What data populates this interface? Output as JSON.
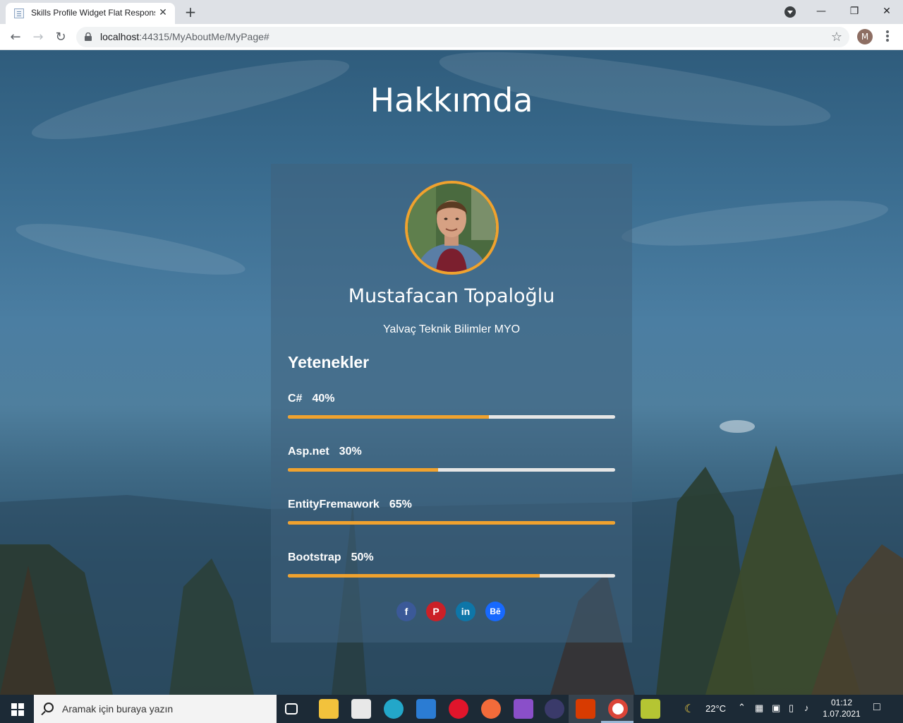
{
  "browser": {
    "tab_title": "Skills Profile Widget Flat Responsive",
    "tab_close": "✕",
    "new_tab": "+",
    "url_host": "localhost",
    "url_rest": ":44315/MyAboutMe/MyPage#",
    "profile_initial": "M",
    "window_controls": {
      "minimize": "—",
      "restore": "❐",
      "close": "✕"
    }
  },
  "page": {
    "title": "Hakkımda",
    "name": "Mustafacan Topaloğlu",
    "school": "Yalvaç Teknik Bilimler MYO",
    "skills_heading": "Yetenekler",
    "skills": [
      {
        "name": "C#",
        "percent_label": "40%",
        "bar_fill": 0.615
      },
      {
        "name": "Asp.net",
        "percent_label": "30%",
        "bar_fill": 0.46
      },
      {
        "name": "EntityFremawork",
        "percent_label": "65%",
        "bar_fill": 1.0
      },
      {
        "name": "Bootstrap",
        "percent_label": "50%",
        "bar_fill": 0.769
      }
    ],
    "social": [
      {
        "name": "facebook",
        "glyph": "f",
        "color": "#3b5998"
      },
      {
        "name": "pinterest",
        "glyph": "P",
        "color": "#cb2027"
      },
      {
        "name": "linkedin",
        "glyph": "in",
        "color": "#0e76a8"
      },
      {
        "name": "behance",
        "glyph": "Bē",
        "color": "#1769ff"
      }
    ],
    "accent_color": "#f0a22e"
  },
  "taskbar": {
    "search_placeholder": "Aramak için buraya yazın",
    "temperature": "22°C",
    "time": "01:12",
    "date": "1.07.2021",
    "apps": [
      "task-view",
      "file-explorer",
      "store",
      "edge",
      "mail",
      "opera",
      "postman",
      "visual-studio",
      "eclipse",
      "office",
      "chrome",
      "app-extra"
    ]
  }
}
